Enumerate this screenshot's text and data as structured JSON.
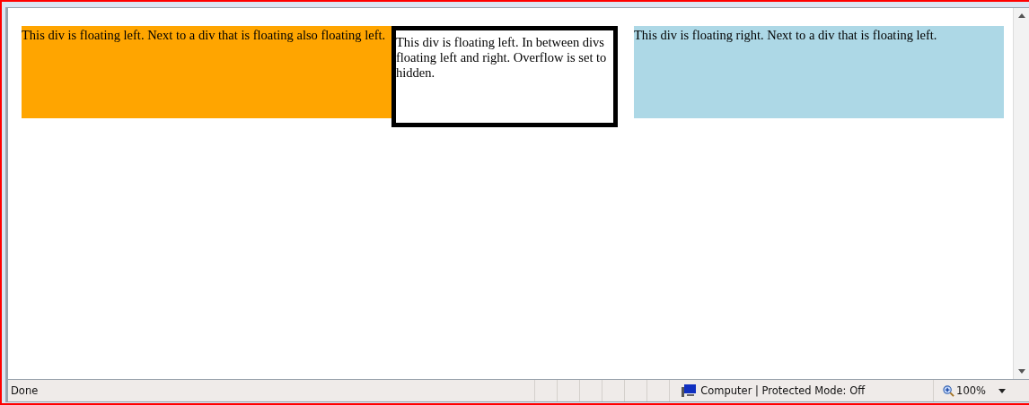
{
  "page": {
    "boxes": [
      {
        "kind": "float_left",
        "text": "This div is floating left. Next to a div that is floating also floating left."
      },
      {
        "kind": "overflow_hidden",
        "text": "This div is floating left. In between divs floating left and right. Overflow is set to hidden."
      },
      {
        "kind": "float_right",
        "text": "This div is floating right. Next to a div that is floating left."
      }
    ]
  },
  "status_bar": {
    "status": "Done",
    "zone": "Computer | Protected Mode: Off",
    "zoom": "100%"
  }
}
